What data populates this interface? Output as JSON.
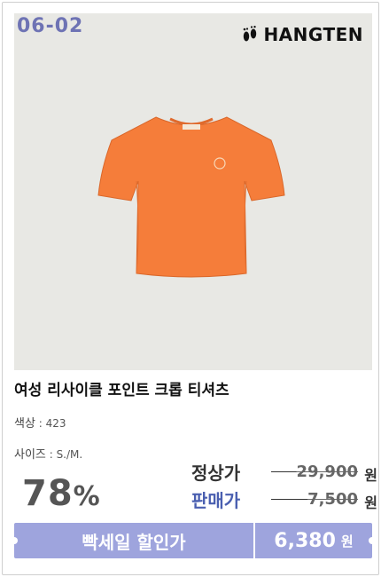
{
  "product": {
    "code": "06-02",
    "brand": "HANGTEN",
    "title": "여성 리사이클 포인트 크롭 티셔츠",
    "color_label": "색상",
    "color_value": " : 423",
    "size_label": "사이즈",
    "size_value": " : S./M.",
    "shirt_color": "#f57d3a"
  },
  "pricing": {
    "discount_number": "78",
    "discount_symbol": "%",
    "regular_label": "정상가",
    "regular_price": "29,900",
    "sale_label": "판매가",
    "sale_price": "7,500",
    "currency": "원"
  },
  "banner": {
    "label": "빡세일 할인가",
    "final_price": "6,380",
    "currency": "원",
    "color": "#9ea4dd"
  }
}
